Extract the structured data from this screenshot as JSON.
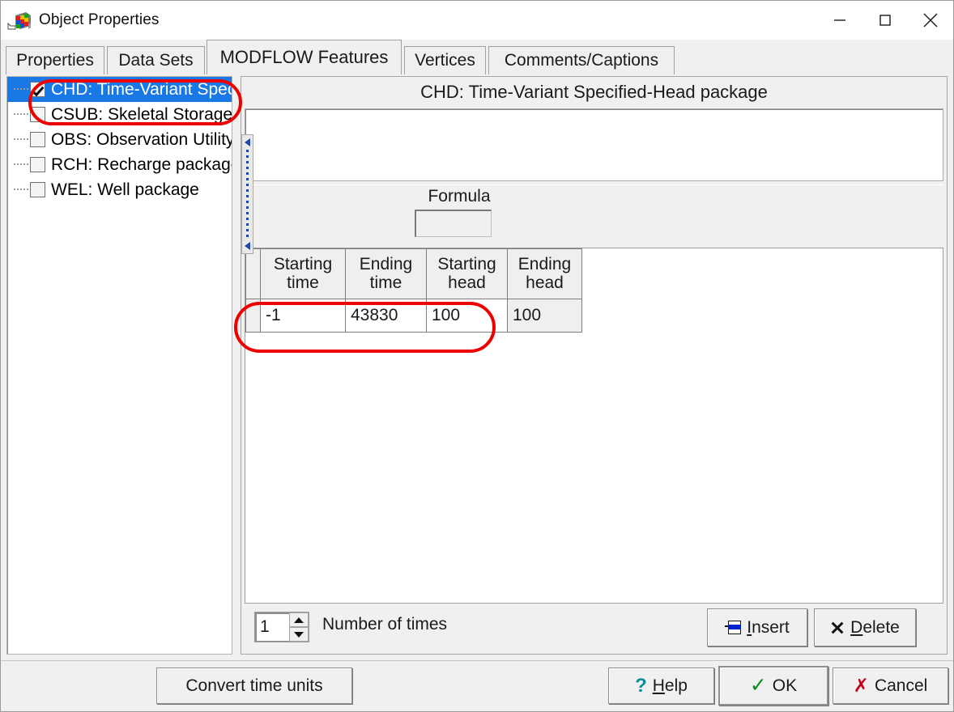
{
  "window": {
    "title": "Object Properties",
    "icon": "modelmuse-cube-icon",
    "controls": {
      "minimize": "minimize-icon",
      "maximize": "maximize-icon",
      "close": "close-icon"
    }
  },
  "tabs": [
    {
      "label": "Properties",
      "active": false
    },
    {
      "label": "Data Sets",
      "active": false
    },
    {
      "label": "MODFLOW Features",
      "active": true
    },
    {
      "label": "Vertices",
      "active": false
    },
    {
      "label": "Comments/Captions",
      "active": false
    }
  ],
  "tree": {
    "items": [
      {
        "label": "CHD: Time-Variant Specified-Head package",
        "checked": true,
        "selected": true
      },
      {
        "label": "CSUB: Skeletal Storage, Compaction, and Subsidence package",
        "checked": false,
        "selected": false
      },
      {
        "label": "OBS: Observation Utility",
        "checked": false,
        "selected": false
      },
      {
        "label": "RCH: Recharge package",
        "checked": false,
        "selected": false
      },
      {
        "label": "WEL: Well package",
        "checked": false,
        "selected": false
      }
    ]
  },
  "pane": {
    "title": "CHD: Time-Variant Specified-Head package",
    "memo_value": "",
    "formula": {
      "label": "Formula",
      "value": ""
    }
  },
  "grid": {
    "columns": [
      {
        "line1": "Starting",
        "line2": "time"
      },
      {
        "line1": "Ending",
        "line2": "time"
      },
      {
        "line1": "Starting",
        "line2": "head"
      },
      {
        "line1": "Ending",
        "line2": "head"
      }
    ],
    "rows": [
      {
        "starting_time": "-1",
        "ending_time": "43830",
        "starting_head": "100",
        "ending_head": "100"
      }
    ]
  },
  "controls": {
    "number_of_times": {
      "value": "1",
      "caption": "Number of times"
    },
    "insert_label": "Insert",
    "insert_accel": "I",
    "delete_label": "Delete",
    "delete_accel": "D"
  },
  "footer": {
    "convert_label": "Convert time units",
    "help_label": "Help",
    "help_accel": "H",
    "ok_label": "OK",
    "cancel_label": "Cancel"
  },
  "colors": {
    "selection": "#1879e6",
    "annotation": "#ee0000",
    "face": "#f0f0f0",
    "ok_check": "#0b8a1e",
    "cancel_x": "#c00018",
    "help_q": "#0f8a96",
    "insert_band": "#0022cc"
  }
}
